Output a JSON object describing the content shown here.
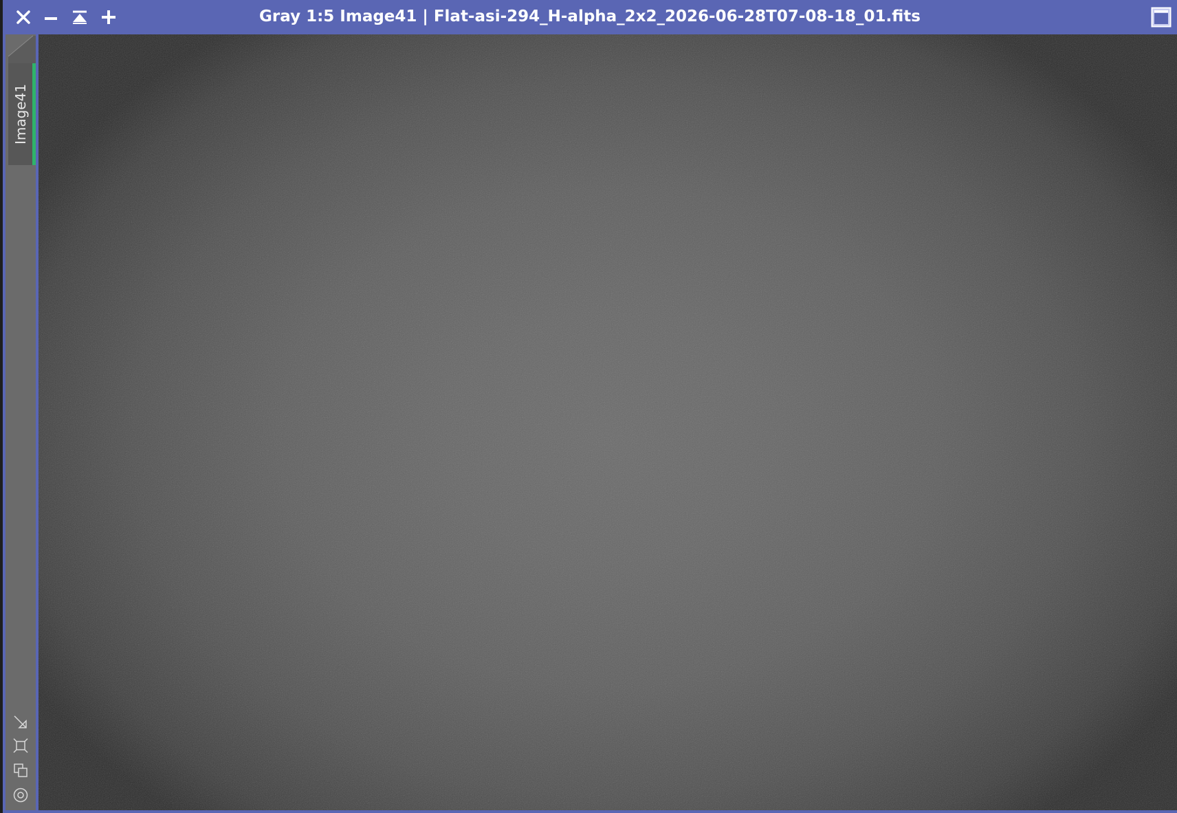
{
  "window": {
    "title": "Gray 1:5 Image41 | Flat-asi-294_H-alpha_2x2_2026-06-28T07-08-18_01.fits",
    "accent_color": "#5a66b4"
  },
  "titlebar_buttons": [
    {
      "name": "close-icon"
    },
    {
      "name": "minimize-icon"
    },
    {
      "name": "shade-icon"
    },
    {
      "name": "add-icon"
    },
    {
      "name": "maximize-icon"
    }
  ],
  "view": {
    "tab_label": "Image41",
    "tab_indicator_color": "#2fb36a"
  },
  "side_tools": [
    {
      "name": "fit-view-icon"
    },
    {
      "name": "zoom-to-extents-icon"
    },
    {
      "name": "clone-view-icon"
    },
    {
      "name": "center-view-icon"
    }
  ]
}
